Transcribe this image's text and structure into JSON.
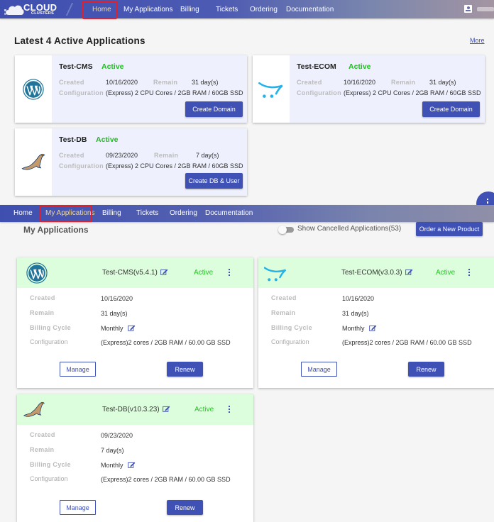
{
  "header": {
    "logo_main": "CLOUD",
    "logo_sub": "CLUSTERS",
    "nav": [
      "Home",
      "My Applications",
      "Billing",
      "Tickets",
      "Ordering",
      "Documentation"
    ],
    "active_nav": "Home"
  },
  "latest": {
    "title": "Latest 4 Active Applications",
    "more_label": "More",
    "labels": {
      "created": "Created",
      "remain": "Remain",
      "configuration": "Configuration"
    },
    "cards": [
      {
        "name": "Test-CMS",
        "status": "Active",
        "created": "10/16/2020",
        "remain": "31 day(s)",
        "configuration": "(Express) 2 CPU Cores / 2GB RAM / 60GB SSD",
        "button": "Create Domain",
        "icon": "wordpress-icon"
      },
      {
        "name": "Test-ECOM",
        "status": "Active",
        "created": "10/16/2020",
        "remain": "31 day(s)",
        "configuration": "(Express) 2 CPU Cores / 2GB RAM / 60GB SSD",
        "button": "Create Domain",
        "icon": "opencart-icon"
      },
      {
        "name": "Test-DB",
        "status": "Active",
        "created": "09/23/2020",
        "remain": "7 day(s)",
        "configuration": "(Express) 2 CPU Cores / 2GB RAM / 60GB SSD",
        "button": "Create DB & User",
        "icon": "mariadb-icon"
      }
    ]
  },
  "header2": {
    "nav": [
      "Home",
      "My Applications",
      "Billing",
      "Tickets",
      "Ordering",
      "Documentation"
    ],
    "active_nav": "My Applications"
  },
  "my_apps": {
    "title": "My Applications",
    "toggle_label": "Show Cancelled Applications(53)",
    "toggle_on": false,
    "order_button": "Order a New Product",
    "labels": {
      "created": "Created",
      "remain": "Remain",
      "billing_cycle": "Billing Cycle",
      "configuration": "Configuration"
    },
    "manage_label": "Manage",
    "renew_label": "Renew",
    "cards": [
      {
        "title": "Test-CMS(v5.4.1)",
        "status": "Active",
        "created": "10/16/2020",
        "remain": "31 day(s)",
        "billing_cycle": "Monthly",
        "configuration": "(Express)2 cores / 2GB RAM / 60.00 GB SSD",
        "icon": "wordpress-icon"
      },
      {
        "title": "Test-ECOM(v3.0.3)",
        "status": "Active",
        "created": "10/16/2020",
        "remain": "31 day(s)",
        "billing_cycle": "Monthly",
        "configuration": "(Express)2 cores / 2GB RAM / 60.00 GB SSD",
        "icon": "opencart-icon"
      },
      {
        "title": "Test-DB(v10.3.23)",
        "status": "Active",
        "created": "09/23/2020",
        "remain": "7 day(s)",
        "billing_cycle": "Monthly",
        "configuration": "(Express)2 cores / 2GB RAM / 60.00 GB SSD",
        "icon": "mariadb-icon"
      }
    ]
  },
  "colors": {
    "primary": "#3f51b5",
    "active_green": "#1fbd1f",
    "card_head_green": "#dcfedc",
    "latest_card_bg": "#eef0fd",
    "highlight_red": "#e0202a"
  }
}
